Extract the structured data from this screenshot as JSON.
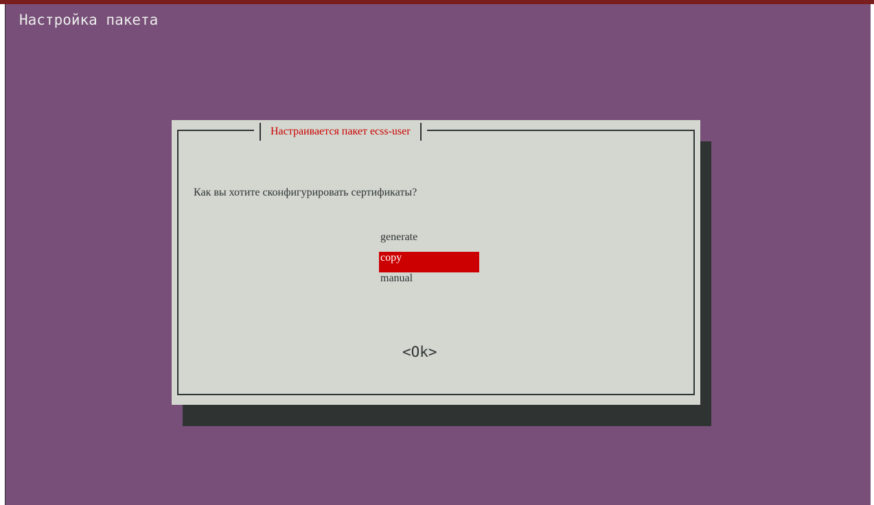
{
  "window": {
    "backtitle": "Настройка пакета"
  },
  "dialog": {
    "title": "Настраивается пакет ecss-user",
    "question": "Как вы хотите сконфигурировать сертификаты?",
    "options": [
      {
        "label": "generate",
        "selected": false
      },
      {
        "label": "copy",
        "selected": true
      },
      {
        "label": "manual",
        "selected": false
      }
    ],
    "ok_label": "<Ok>"
  },
  "colors": {
    "background": "#774f78",
    "dialog": "#d3d7cf",
    "shadow": "#2f3432",
    "accent": "#cc0000",
    "text": "#2e3436",
    "backtitle_text": "#ececec"
  }
}
